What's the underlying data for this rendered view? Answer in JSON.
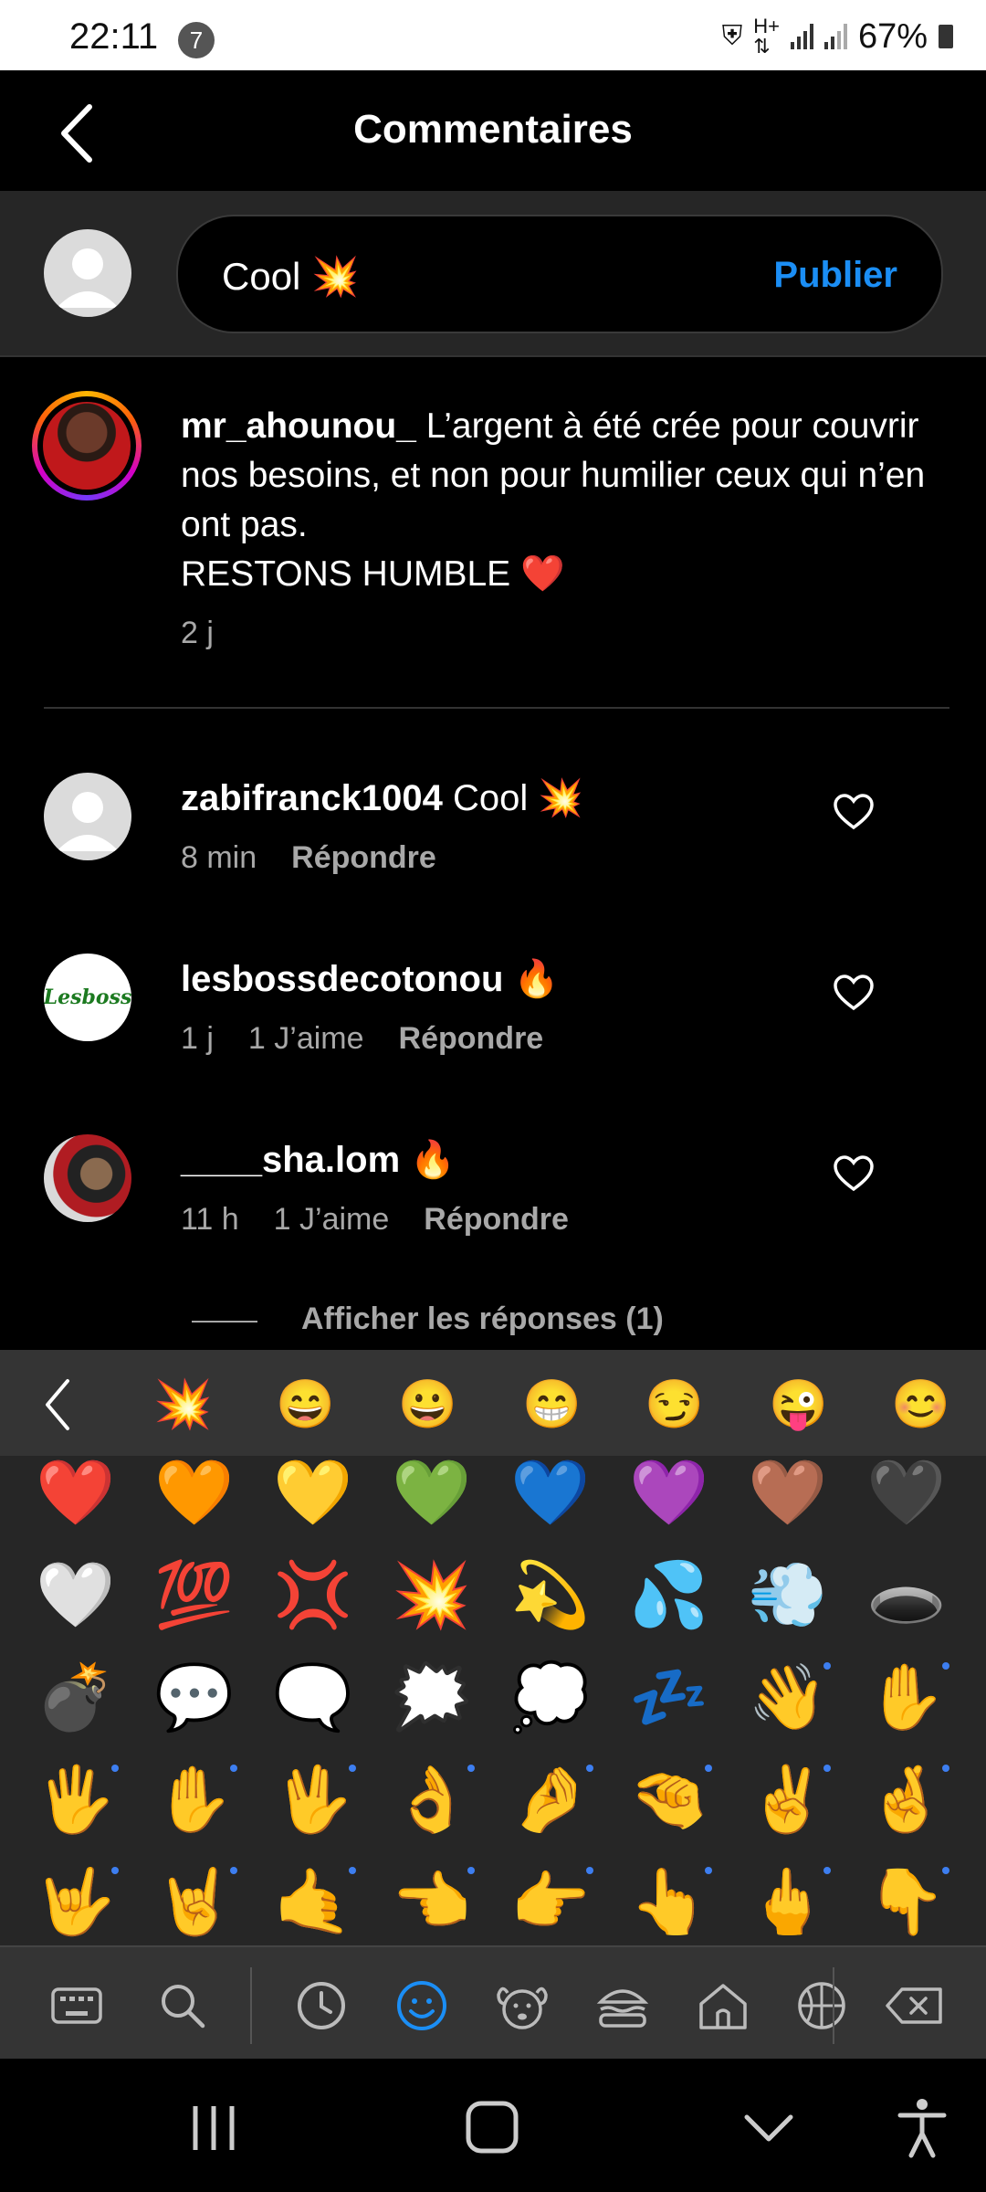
{
  "status_bar": {
    "time": "22:11",
    "notification_count": "7",
    "battery": "67%"
  },
  "header": {
    "title": "Commentaires"
  },
  "compose": {
    "text": "Cool 💥",
    "publish_label": "Publier"
  },
  "caption": {
    "username": "mr_ahounou_",
    "text": "L’argent à été crée pour couvrir nos besoins, et non pour humilier ceux qui n’en ont pas.",
    "text2": "RESTONS HUMBLE ❤️",
    "age": "2 j"
  },
  "comments": [
    {
      "username": "zabifranck1004",
      "text": "Cool 💥",
      "time": "8 min",
      "likes": "",
      "reply_label": "Répondre"
    },
    {
      "username": "lesbossdecotonou",
      "text": "🔥",
      "time": "1 j",
      "likes": "1 J’aime",
      "reply_label": "Répondre",
      "avatar_text": "Lesboss"
    },
    {
      "username": "____sha.lom",
      "text": "🔥",
      "time": "11 h",
      "likes": "1 J’aime",
      "reply_label": "Répondre"
    }
  ],
  "view_replies": "Afficher les réponses (1)",
  "keyboard": {
    "recent": [
      "💥",
      "😄",
      "😀",
      "😁",
      "😏",
      "😜",
      "😊"
    ],
    "grid": [
      "❤️",
      "🧡",
      "💛",
      "💚",
      "💙",
      "💜",
      "🤎",
      "🖤",
      "🤍",
      "💯",
      "💢",
      "💥",
      "💫",
      "💦",
      "💨",
      "🕳️",
      "💣",
      "💬",
      "🗨️",
      "🗯️",
      "💭",
      "💤",
      "👋",
      "✋",
      "🖐️",
      "✋",
      "🖖",
      "👌",
      "🤌",
      "🤏",
      "✌️",
      "🤞",
      "🤟",
      "🤘",
      "🤙",
      "👈",
      "👉",
      "👆",
      "🖕",
      "👇"
    ],
    "active_tool_color": "#1b8ef5"
  }
}
